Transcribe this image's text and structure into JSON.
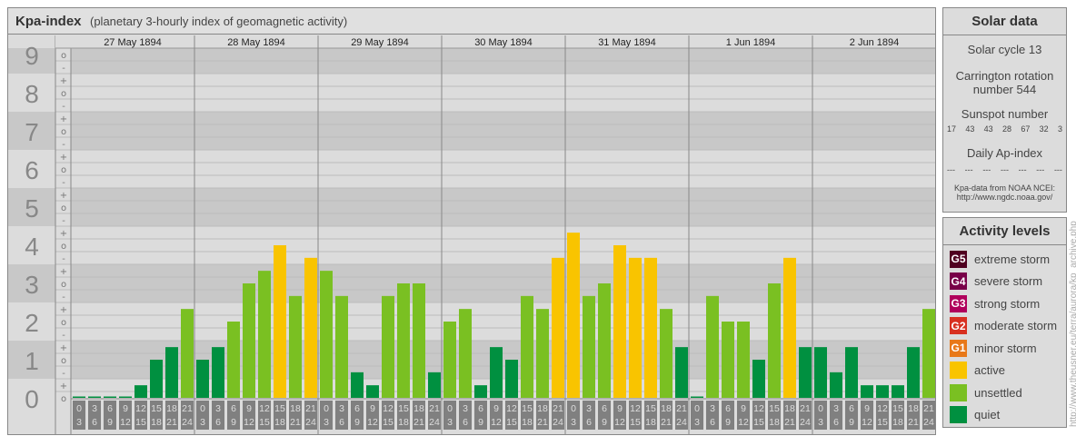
{
  "header": {
    "title": "Kpa-index",
    "subtitle": "(planetary 3-hourly index of geomagnetic activity)"
  },
  "chart_data": {
    "type": "bar",
    "title": "Kpa-index",
    "ylim": [
      0,
      9
    ],
    "y_ticks": [
      "0",
      "1",
      "2",
      "3",
      "4",
      "5",
      "6",
      "7",
      "8",
      "9"
    ],
    "sub_ticks": [
      "o",
      "+",
      "-"
    ],
    "days": [
      "27 May 1894",
      "28 May 1894",
      "29 May 1894",
      "30 May 1894",
      "31 May 1894",
      "1 Jun 1894",
      "2 Jun 1894"
    ],
    "hours": [
      [
        "0",
        "3"
      ],
      [
        "3",
        "6"
      ],
      [
        "6",
        "9"
      ],
      [
        "9",
        "12"
      ],
      [
        "12",
        "15"
      ],
      [
        "15",
        "18"
      ],
      [
        "18",
        "21"
      ],
      [
        "21",
        "24"
      ]
    ],
    "values": [
      [
        0,
        0,
        0,
        0,
        0.33,
        1,
        1.33,
        2.33
      ],
      [
        1,
        1.33,
        2,
        3,
        3.33,
        4,
        2.67,
        3.67
      ],
      [
        3.33,
        2.67,
        0.67,
        0.33,
        2.67,
        3,
        3,
        0.67
      ],
      [
        2,
        2.33,
        0.33,
        1.33,
        1,
        2.67,
        2.33,
        3.67
      ],
      [
        4.33,
        2.67,
        3,
        4,
        3.67,
        3.67,
        2.33,
        1.33
      ],
      [
        0,
        2.67,
        2,
        2,
        1,
        3,
        3.67,
        1.33
      ],
      [
        1.33,
        0.67,
        1.33,
        0.33,
        0.33,
        0.33,
        1.33,
        2.33
      ]
    ],
    "colors": {
      "quiet": "#009040",
      "unsettled": "#7ac022",
      "active": "#f9c400"
    }
  },
  "solar": {
    "title": "Solar data",
    "cycle": "Solar cycle 13",
    "carrington1": "Carrington rotation",
    "carrington2": "number 544",
    "sunspot_label": "Sunspot number",
    "sunspots": [
      "17",
      "43",
      "43",
      "28",
      "67",
      "32",
      "3"
    ],
    "ap_label": "Daily Ap-index",
    "ap": [
      "---",
      "---",
      "---",
      "---",
      "---",
      "---",
      "---"
    ],
    "source1": "Kpa-data from NOAA NCEI:",
    "source2": "http://www.ngdc.noaa.gov/"
  },
  "levels": {
    "title": "Activity levels",
    "items": [
      {
        "code": "G5",
        "label": "extreme storm",
        "color": "#500020"
      },
      {
        "code": "G4",
        "label": "severe storm",
        "color": "#780048"
      },
      {
        "code": "G3",
        "label": "strong storm",
        "color": "#b0005c"
      },
      {
        "code": "G2",
        "label": "moderate storm",
        "color": "#d83020"
      },
      {
        "code": "G1",
        "label": "minor storm",
        "color": "#e87818"
      },
      {
        "code": "",
        "label": "active",
        "color": "#f9c400"
      },
      {
        "code": "",
        "label": "unsettled",
        "color": "#7ac022"
      },
      {
        "code": "",
        "label": "quiet",
        "color": "#009040"
      }
    ]
  },
  "watermark": "http://www.theusner.eu/terra/aurora/kp_archive.php"
}
